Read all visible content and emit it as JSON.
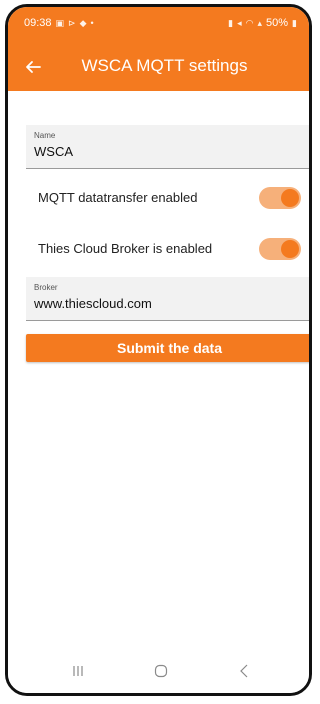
{
  "status_bar": {
    "time": "09:38",
    "battery": "50%",
    "left_icons": [
      "image-icon",
      "cast-icon",
      "media-icon",
      "dot-icon"
    ],
    "right_icons": [
      "battery-saver-icon",
      "mute-icon",
      "wifi-icon",
      "signal-icon",
      "battery-icon"
    ]
  },
  "app_bar": {
    "title": "WSCA MQTT settings",
    "back_icon": "arrow-left-icon"
  },
  "form": {
    "name": {
      "label": "Name",
      "value": "WSCA"
    },
    "mqtt_switch": {
      "label": "MQTT datatransfer enabled",
      "enabled": true
    },
    "cloud_switch": {
      "label": "Thies Cloud Broker is enabled",
      "enabled": true
    },
    "broker": {
      "label": "Broker",
      "value": "www.thiescloud.com"
    },
    "submit_label": "Submit the data"
  },
  "navigation_bar": {
    "buttons": [
      "recent-apps-icon",
      "home-icon",
      "back-icon"
    ]
  },
  "colors": {
    "accent": "#f47a1f",
    "switch_track": "#f6b07a",
    "field_background": "#f2f2f2"
  }
}
